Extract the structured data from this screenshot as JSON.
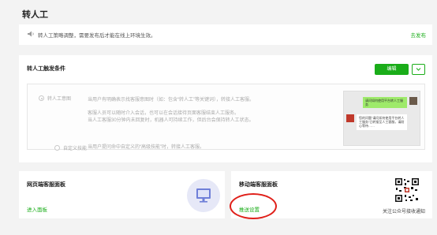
{
  "page": {
    "title": "转人工"
  },
  "notice": {
    "text": "转人工策略调整，需要发布后才能在线上环境生效。",
    "link": "去发布"
  },
  "trigger": {
    "title": "转人工触发条件",
    "edit_label": "编辑",
    "options": [
      {
        "label": "转人工意图",
        "desc": [
          "当用户有明确表示找客服意图时（如：包含“转人工”等关键词），转接人工客服。",
          "客服人员可以随时介入会话，也可以在会话接待页面客服结束人工服务。",
          "当人工客服30分钟内未回复时，机器人可持续工作，但后台会保持转人工状态。"
        ]
      },
      {
        "label": "自定义技能",
        "desc": [
          "当用户提问命中自定义的“高级技能”时，转接人工客服。"
        ]
      }
    ],
    "preview": {
      "user_msg": "请问如何使用平台转人工服务",
      "bot_msg": "您的问题“请问如何使用平台转人工服务”已转接至人工客服，请耐心等待……"
    }
  },
  "web_panel": {
    "title": "网页端客服面板",
    "link": "进入面板",
    "icon": "monitor-icon"
  },
  "mobile_panel": {
    "title": "移动端客服面板",
    "link": "推送设置",
    "qr_caption": "关注公众号接收通知",
    "icon": "qr-code"
  },
  "colors": {
    "accent": "#1aad19",
    "highlight": "#e0201a"
  }
}
